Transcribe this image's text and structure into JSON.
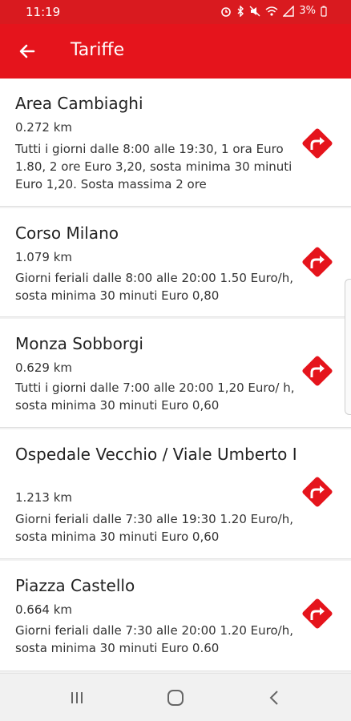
{
  "status_bar": {
    "time": "11:19",
    "battery": "3%"
  },
  "app_bar": {
    "title": "Tariffe"
  },
  "colors": {
    "accent": "#e5141c",
    "status_bar": "#d91a1f"
  },
  "items": [
    {
      "name": "Area Cambiaghi",
      "distance": "0.272 km",
      "description": "Tutti i giorni dalle 8:00 alle 19:30, 1 ora Euro 1.80, 2 ore Euro 3,20, sosta minima 30 minuti Euro 1,20. Sosta massima 2 ore",
      "icon": "directions-icon"
    },
    {
      "name": "Corso Milano",
      "distance": "1.079 km",
      "description": "Giorni feriali dalle 8:00 alle 20:00 1.50 Euro/h, sosta minima 30 minuti Euro 0,80",
      "icon": "directions-icon"
    },
    {
      "name": "Monza Sobborgi",
      "distance": "0.629 km",
      "description": "Tutti i giorni dalle 7:00 alle 20:00 1,20 Euro/ h, sosta minima 30 minuti Euro 0,60",
      "icon": "directions-icon"
    },
    {
      "name": "Ospedale Vecchio / Viale Umberto I",
      "distance": "1.213 km",
      "description": "Giorni feriali dalle 7:30 alle 19:30 1.20 Euro/h, sosta minima 30 minuti Euro 0,60",
      "icon": "directions-icon"
    },
    {
      "name": "Piazza Castello",
      "distance": "0.664 km",
      "description": "Giorni feriali dalle 7:30 alle 20:00 1.20 Euro/h, sosta minima 30 minuti Euro 0.60",
      "icon": "directions-icon"
    }
  ]
}
